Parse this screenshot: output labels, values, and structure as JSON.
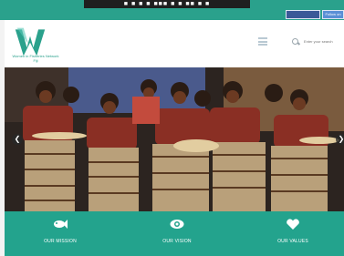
{
  "top_bar": {
    "tab_text": "■ ■ ■ ■ ■■■ ■ ■ ■■ ■ ■"
  },
  "social": {
    "twitter_label": "Follow on Twitter"
  },
  "header": {
    "org_name": "Women in Fisheries Network Fiji",
    "search_placeholder": "Enter your search"
  },
  "features": [
    {
      "label": "OUR MISSION",
      "icon": "fish-icon"
    },
    {
      "label": "OUR VISION",
      "icon": "eye-icon"
    },
    {
      "label": "OUR VALUES",
      "icon": "heart-icon"
    }
  ],
  "colors": {
    "teal": "#2aa18c",
    "footer_teal": "#23a38d"
  }
}
